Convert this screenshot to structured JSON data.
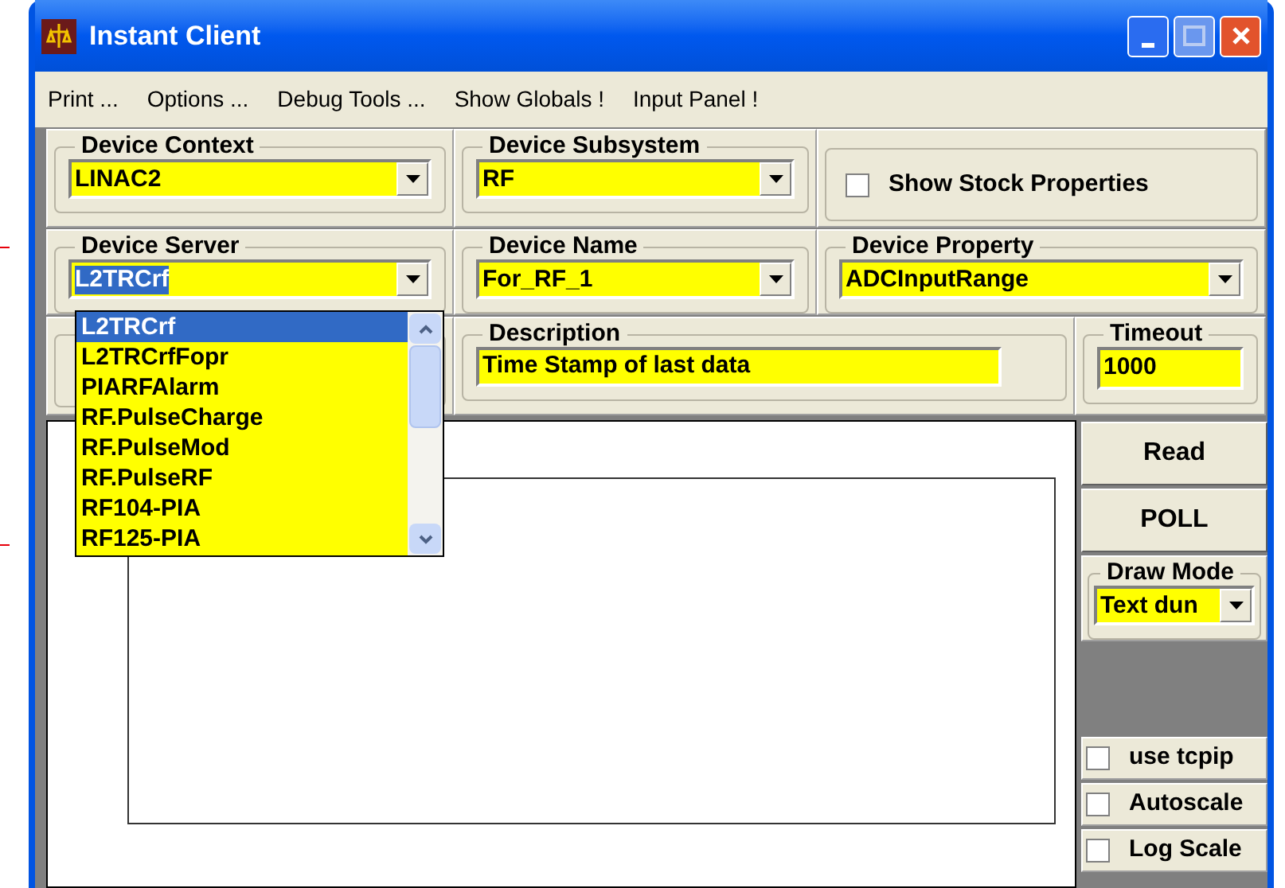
{
  "window": {
    "title": "Instant Client"
  },
  "menu": [
    "Print ...",
    "Options ...",
    "Debug Tools ...",
    "Show Globals !",
    "Input Panel !"
  ],
  "device_context": {
    "label": "Device Context",
    "value": "LINAC2"
  },
  "device_subsystem": {
    "label": "Device Subsystem",
    "value": "RF"
  },
  "show_stock_properties": {
    "label": "Show Stock Properties",
    "checked": false
  },
  "device_server": {
    "label": "Device Server",
    "value": "L2TRCrf",
    "expanded": true,
    "options": [
      {
        "label": "L2TRCrf",
        "selected": true
      },
      {
        "label": "L2TRCrfFopr",
        "selected": false
      },
      {
        "label": "PIARFAlarm",
        "selected": false
      },
      {
        "label": "RF.PulseCharge",
        "selected": false
      },
      {
        "label": "RF.PulseMod",
        "selected": false
      },
      {
        "label": "RF.PulseRF",
        "selected": false
      },
      {
        "label": "RF104-PIA",
        "selected": false
      },
      {
        "label": "RF125-PIA",
        "selected": false
      }
    ]
  },
  "device_name": {
    "label": "Device Name",
    "value": "For_RF_1"
  },
  "device_property": {
    "label": "Device Property",
    "value": "ADCInputRange"
  },
  "description": {
    "label": "Description",
    "value": "Time Stamp of last data"
  },
  "timeout": {
    "label": "Timeout",
    "value": "1000"
  },
  "buttons": [
    "Read",
    "POLL"
  ],
  "draw_mode": {
    "label": "Draw Mode",
    "value": "Text dun"
  },
  "checkboxes": [
    {
      "label": "use tcpip",
      "checked": false
    },
    {
      "label": "Autoscale",
      "checked": false
    },
    {
      "label": "Log Scale",
      "checked": false
    }
  ]
}
